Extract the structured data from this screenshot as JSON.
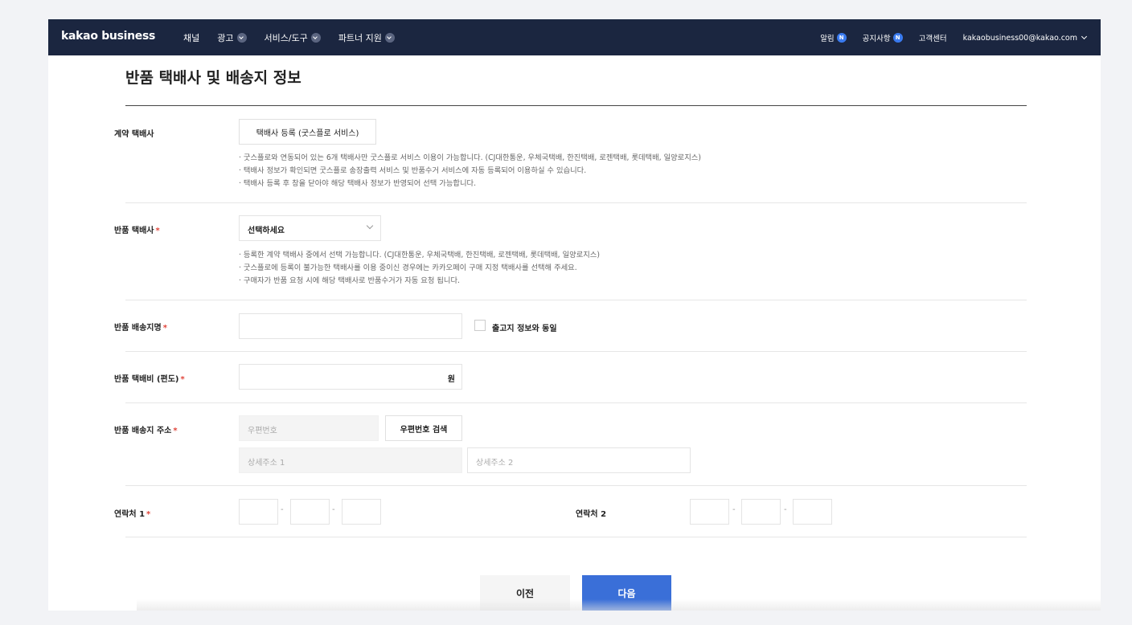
{
  "gnb": {
    "logo": "kakao business",
    "nav": [
      {
        "label": "채널",
        "has_dropdown": false
      },
      {
        "label": "광고",
        "has_dropdown": true
      },
      {
        "label": "서비스/도구",
        "has_dropdown": true
      },
      {
        "label": "파트너 지원",
        "has_dropdown": true
      }
    ],
    "util": {
      "alarm": "알림",
      "notice": "공지사항",
      "badge": "N",
      "support": "고객센터",
      "account": "kakaobusiness00@kakao.com"
    }
  },
  "page": {
    "title": "반품 택배사 및 배송지 정보"
  },
  "form": {
    "contract_courier": {
      "label": "계약 택배사",
      "button": "택배사 등록 (굿스플로 서비스)",
      "notes": [
        "굿스플로와 연동되어 있는 6개 택배사만 굿스플로 서비스 이용이 가능합니다. (CJ대한통운, 우체국택배, 한진택배, 로젠택배, 롯데택배, 일양로지스)",
        "택배사 정보가 확인되면 굿스플로 송장출력 서비스 및 반품수거 서비스에 자동 등록되어 이용하실 수 있습니다.",
        "택배사 등록 후 창을 닫아야 해당 택배사 정보가 반영되어 선택 가능합니다."
      ]
    },
    "return_courier": {
      "label": "반품 택배사",
      "required": "*",
      "select_value": "선택하세요",
      "notes": [
        "등록한 계약 택배사 중에서 선택 가능합니다. (CJ대한통운, 우체국택배, 한진택배, 로젠택배, 롯데택배, 일양로지스)",
        "굿스플로에 등록이 불가능한 택배사를 이용 중이신 경우에는 카카오페이 구매 지정 택배사를 선택해 주세요.",
        "구매자가 반품 요청 시에 해당 택배사로 반품수거가 자동 요청 됩니다."
      ]
    },
    "return_place_name": {
      "label": "반품 배송지명",
      "required": "*",
      "value": "",
      "same_as_label": "출고지 정보와 동일"
    },
    "return_fee": {
      "label": "반품 택배비 (편도)",
      "required": "*",
      "value": "",
      "unit": "원"
    },
    "return_address": {
      "label": "반품 배송지 주소",
      "required": "*",
      "zip_placeholder": "우편번호",
      "zip_search_button": "우편번호 검색",
      "detail1_placeholder": "상세주소 1",
      "detail2_placeholder": "상세주소 2"
    },
    "contact1": {
      "label": "연락처 1",
      "required": "*",
      "separator": "-"
    },
    "contact2": {
      "label": "연락처 2",
      "separator": "-"
    }
  },
  "actions": {
    "prev": "이전",
    "next": "다음"
  }
}
